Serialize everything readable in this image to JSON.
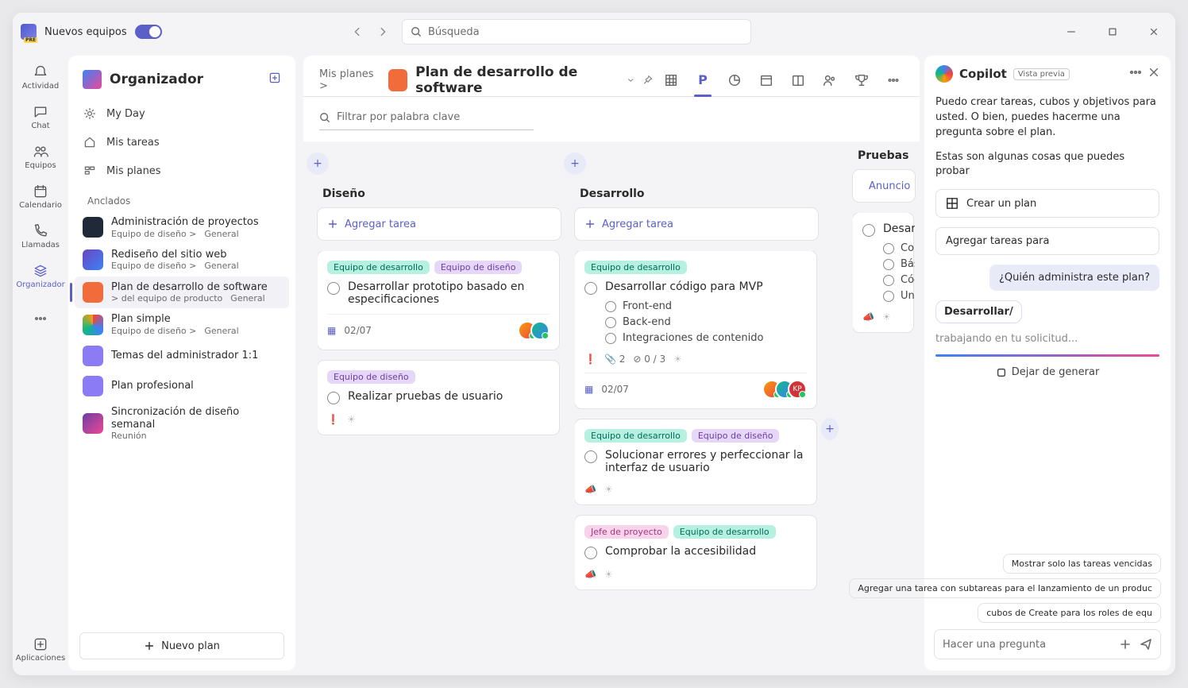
{
  "titlebar": {
    "brand_label": "Nuevos equipos",
    "search_placeholder": "Búsqueda"
  },
  "rail": [
    {
      "key": "activity",
      "label": "Actividad"
    },
    {
      "key": "chat",
      "label": "Chat"
    },
    {
      "key": "teams",
      "label": "Equipos"
    },
    {
      "key": "calendar",
      "label": "Calendario"
    },
    {
      "key": "calls",
      "label": "Llamadas"
    },
    {
      "key": "planner",
      "label": "Organizador"
    },
    {
      "key": "apps",
      "label": "Aplicaciones"
    }
  ],
  "sidebar": {
    "title": "Organizador",
    "nav": [
      {
        "label": "My Day"
      },
      {
        "label": "Mis tareas"
      },
      {
        "label": "Mis planes"
      }
    ],
    "pinned_label": "Anclados",
    "pinned": [
      {
        "title": "Administración de proyectos",
        "sub": "Equipo de diseño >",
        "channel": "General",
        "color": "#1f2937"
      },
      {
        "title": "Rediseño del sitio web",
        "sub": "Equipo de diseño >",
        "channel": "General",
        "color": "linear-gradient(135deg,#6b46c1,#3b82f6)"
      },
      {
        "title": "Plan de desarrollo de software",
        "sub": "> del equipo de producto",
        "channel": "General",
        "color": "#f26b3a"
      },
      {
        "title": "Plan simple",
        "sub": "Equipo de diseño >",
        "channel": "General",
        "color": "conic-gradient(#ef4444,#3b82f6,#10b981,#f59e0b)"
      },
      {
        "title": "Temas del administrador 1:1",
        "sub": "",
        "channel": "",
        "color": "#8b7cf6"
      },
      {
        "title": "Plan profesional",
        "sub": "",
        "channel": "",
        "color": "#8b7cf6"
      },
      {
        "title": "Sincronización de diseño semanal",
        "sub": "Reunión",
        "channel": "",
        "color": "linear-gradient(135deg,#6b3fa0,#ec4899)"
      }
    ],
    "active_index": 2,
    "new_plan_label": "Nuevo plan"
  },
  "plan": {
    "breadcrumb": "Mis planes >",
    "title": "Plan de desarrollo de software",
    "filter_placeholder": "Filtrar por palabra clave",
    "columns": [
      {
        "name": "Diseño",
        "add_label": "Agregar tarea",
        "cards": [
          {
            "tags": [
              {
                "text": "Equipo de desarrollo",
                "c": "teal"
              },
              {
                "text": "Equipo de diseño",
                "c": "lilac"
              }
            ],
            "title": "Desarrollar prototipo basado en especificaciones",
            "date": "02/07",
            "avatars": 2
          },
          {
            "tags": [
              {
                "text": "Equipo de diseño",
                "c": "lilac"
              }
            ],
            "title": "Realizar pruebas de usuario",
            "flag": true
          }
        ]
      },
      {
        "name": "Desarrollo",
        "add_label": "Agregar tarea",
        "cards": [
          {
            "tags": [
              {
                "text": "Equipo de desarrollo",
                "c": "teal"
              }
            ],
            "title": "Desarrollar código para MVP",
            "subs": [
              "Front-end",
              "Back-end",
              "Integraciones de contenido"
            ],
            "attach": 2,
            "check": "0 / 3",
            "flag": true,
            "date": "02/07",
            "avatars": 3,
            "kp": true
          },
          {
            "tags": [
              {
                "text": "Equipo de desarrollo",
                "c": "teal"
              },
              {
                "text": "Equipo de diseño",
                "c": "lilac"
              }
            ],
            "title": "Solucionar errores y perfeccionar la interfaz de usuario",
            "speak": true
          },
          {
            "tags": [
              {
                "text": "Jefe de proyecto",
                "c": "pink"
              },
              {
                "text": "Equipo de desarrollo",
                "c": "teal"
              }
            ],
            "title": "Comprobar la accesibilidad",
            "speak": true
          }
        ]
      },
      {
        "name": "Pruebas",
        "add_label": "Anuncio",
        "cards": [
          {
            "title": "Desarrollar/",
            "subs": [
              "Con.",
              "Básica",
              "Código",
              "Unidad"
            ],
            "speak": true
          }
        ]
      }
    ]
  },
  "copilot": {
    "title": "Copilot",
    "badge": "Vista previa",
    "intro": "Puedo crear tareas, cubos y objetivos para usted. O bien, puedes hacerme una pregunta sobre el plan.",
    "prompt_label": "Estas son algunas cosas que puedes probar",
    "suggestions": [
      "Crear un plan",
      "Agregar tareas para"
    ],
    "user_msg": "¿Quién administra este plan?",
    "working": "trabajando en tu solicitud...",
    "stop_label": "Dejar de generar",
    "chips": [
      "Mostrar solo las tareas vencidas",
      "Agregar una tarea con subtareas para el lanzamiento de un produc",
      "cubos de Create para los roles de equ"
    ],
    "ask_placeholder": "Hacer una pregunta"
  }
}
